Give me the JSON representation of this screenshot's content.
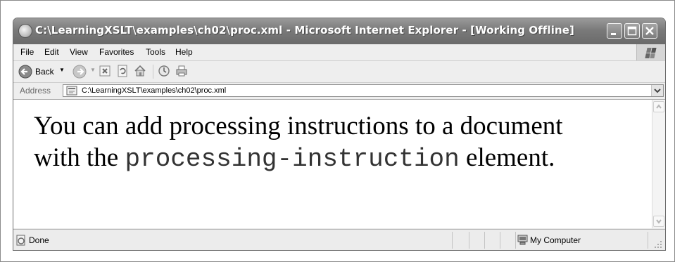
{
  "window": {
    "title": "C:\\LearningXSLT\\examples\\ch02\\proc.xml - Microsoft Internet Explorer - [Working Offline]"
  },
  "menu": {
    "items": [
      "File",
      "Edit",
      "View",
      "Favorites",
      "Tools",
      "Help"
    ]
  },
  "toolbar": {
    "back_label": "Back"
  },
  "address": {
    "label": "Address",
    "value": "C:\\LearningXSLT\\examples\\ch02\\proc.xml"
  },
  "content": {
    "line1": "You can add processing instructions to a document",
    "line2_before": "with the ",
    "line2_code": "processing-instruction",
    "line2_after": " element."
  },
  "status": {
    "text": "Done",
    "zone": "My Computer"
  },
  "icons": {
    "title": "ie-page-icon",
    "back": "back-arrow-icon",
    "forward": "forward-arrow-icon",
    "stop": "stop-icon",
    "refresh": "refresh-icon",
    "home": "home-icon",
    "history": "history-icon",
    "print": "print-icon"
  }
}
